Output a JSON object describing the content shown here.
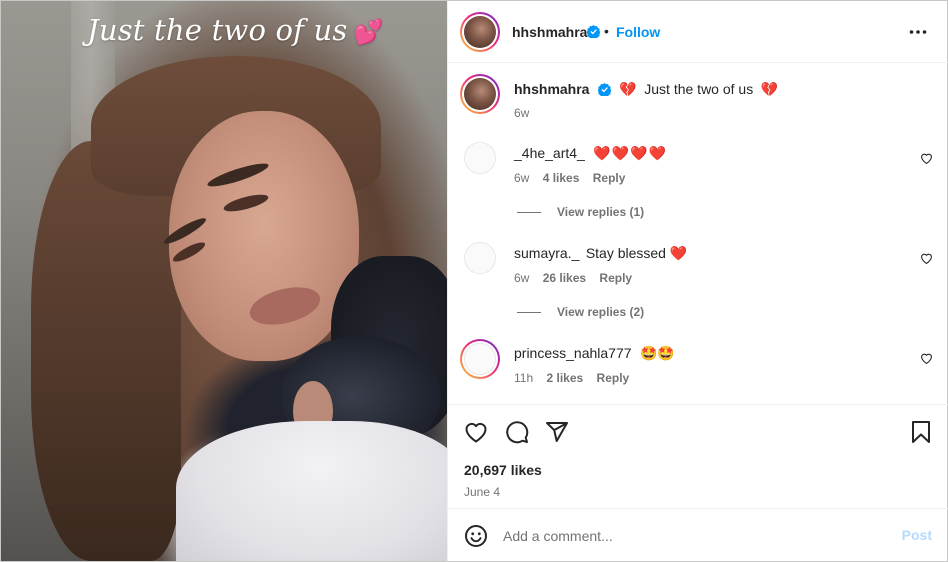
{
  "photo": {
    "caption_text": "Just the two of us",
    "caption_emoji": "💕"
  },
  "post": {
    "author": "hhshmahra",
    "follow_label": "Follow",
    "separator": "•",
    "caption_prefix_emoji": "💔",
    "caption_text": "Just the two of us",
    "caption_suffix_emoji": "💔",
    "caption_age": "6w",
    "likes_text": "20,697 likes",
    "date": "June 4"
  },
  "comments": [
    {
      "username": "_4he_art4_",
      "text": "❤️❤️❤️❤️",
      "age": "6w",
      "likes": "4 likes",
      "reply_label": "Reply",
      "view_replies": "View replies (1)"
    },
    {
      "username": "sumayra._",
      "text": "Stay blessed ❤️",
      "age": "6w",
      "likes": "26 likes",
      "reply_label": "Reply",
      "view_replies": "View replies (2)"
    },
    {
      "username": "princess_nahla777",
      "text": "🤩🤩",
      "age": "11h",
      "likes": "2 likes",
      "reply_label": "Reply"
    }
  ],
  "add_comment": {
    "placeholder": "Add a comment...",
    "post_label": "Post"
  },
  "colors": {
    "link_blue": "#0095f6",
    "post_disabled": "#b3dbff",
    "verified_blue": "#0095f6",
    "heart_red": "#e0162b"
  },
  "icons": [
    "verified-badge-icon",
    "more-options-icon",
    "heart-icon",
    "comment-icon",
    "share-icon",
    "bookmark-icon",
    "emoji-icon"
  ]
}
